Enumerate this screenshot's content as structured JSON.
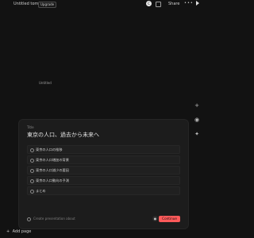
{
  "topbar": {
    "title": "Untitled tome",
    "badge": "Upgrade",
    "share": "Share",
    "more": "•••",
    "circle_btn": "C"
  },
  "canvas": {
    "placeholder_title": "Untitled"
  },
  "panel": {
    "label": "Title",
    "title": "東京の人口、過去から未来へ",
    "outline": [
      {
        "label": "東京の人口の推移"
      },
      {
        "label": "東京の人口増加の背景"
      },
      {
        "label": "東京の人口減少の要因"
      },
      {
        "label": "東京の人口動向の予測"
      },
      {
        "label": "まとめ"
      }
    ],
    "prompt_placeholder": "Create presentation about",
    "continue_label": "Continue"
  },
  "footer": {
    "add_page": "Add page"
  },
  "colors": {
    "accent": "#ff5a5a",
    "background": "#121212",
    "panel": "#1c1c1c"
  }
}
